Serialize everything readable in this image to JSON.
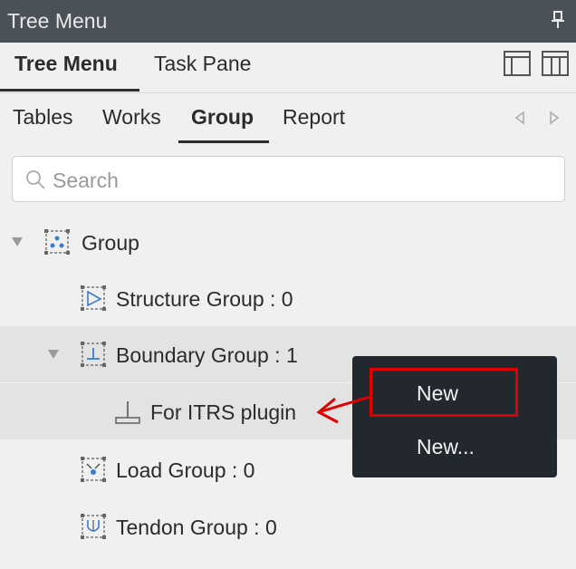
{
  "panel": {
    "title": "Tree Menu"
  },
  "top_tabs": [
    {
      "label": "Tree Menu",
      "active": true
    },
    {
      "label": "Task Pane",
      "active": false
    }
  ],
  "sub_tabs": [
    {
      "label": "Tables",
      "active": false
    },
    {
      "label": "Works",
      "active": false
    },
    {
      "label": "Group",
      "active": true
    },
    {
      "label": "Report",
      "active": false
    }
  ],
  "search": {
    "placeholder": "Search",
    "value": ""
  },
  "tree": [
    {
      "label": "Group",
      "expanded": true,
      "icon": "group-icon"
    },
    {
      "label": "Structure Group : 0",
      "icon": "structure-group-icon"
    },
    {
      "label": "Boundary Group : 1",
      "expanded": true,
      "selected": true,
      "icon": "boundary-group-icon"
    },
    {
      "label": "For ITRS plugin",
      "icon": "support-icon"
    },
    {
      "label": "Load Group : 0",
      "icon": "load-group-icon"
    },
    {
      "label": "Tendon Group : 0",
      "icon": "tendon-group-icon"
    }
  ],
  "context_menu": {
    "items": [
      {
        "label": "New",
        "highlighted": true
      },
      {
        "label": "New..."
      }
    ]
  },
  "colors": {
    "titlebar": "#4b5158",
    "menu_bg": "#22282e",
    "annotation": "#e00000",
    "icon_blue": "#3a7bd5"
  }
}
